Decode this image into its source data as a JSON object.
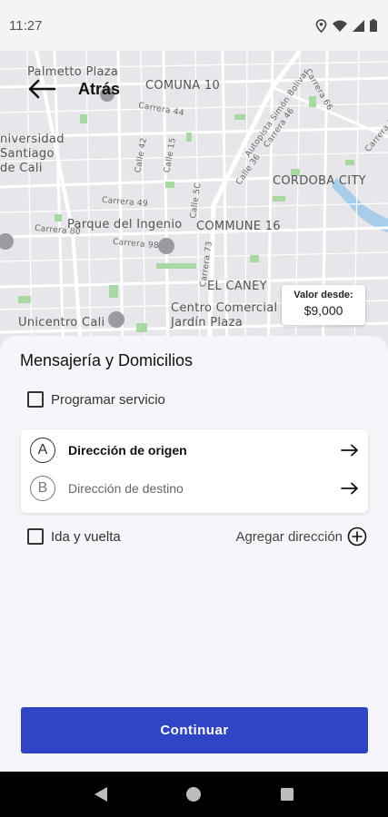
{
  "status_bar": {
    "time": "11:27",
    "icons": [
      "location-icon",
      "wifi-icon",
      "signal-icon",
      "battery-icon"
    ]
  },
  "header": {
    "back_label": "Atrás"
  },
  "map": {
    "labels": [
      "Palmetto Plaza",
      "COMUNA 10",
      "niversidad",
      "Santiago",
      "de Cali",
      "CORDOBA CITY",
      "Parque del Ingenio",
      "COMMUNE 16",
      "EL CANEY",
      "Unicentro Cali",
      "Centro Comercial",
      "Jardín Plaza"
    ],
    "street_labels": [
      "Carrera 44",
      "Carrera 66",
      "Autopista Simón Bolívar",
      "Carrera 46",
      "Calle 36",
      "Carrera 50",
      "Calle 42",
      "Calle 15",
      "Carrera 49",
      "Carrera 80",
      "Carrera 98",
      "Calle 5C",
      "Carrera 73"
    ],
    "price_card": {
      "label": "Valor desde:",
      "value": "$9,000"
    }
  },
  "sheet": {
    "title": "Mensajería y Domicilios",
    "schedule_label": "Programar servicio",
    "origin": {
      "letter": "A",
      "label": "Dirección de origen"
    },
    "destination": {
      "letter": "B",
      "label": "Dirección de destino"
    },
    "round_trip_label": "Ida y vuelta",
    "add_address_label": "Agregar dirección",
    "continue_label": "Continuar"
  },
  "colors": {
    "primary": "#2f45c5",
    "map_background": "#e6e6ea",
    "park_green": "#a8d8a0",
    "water": "#9cc6e8"
  }
}
